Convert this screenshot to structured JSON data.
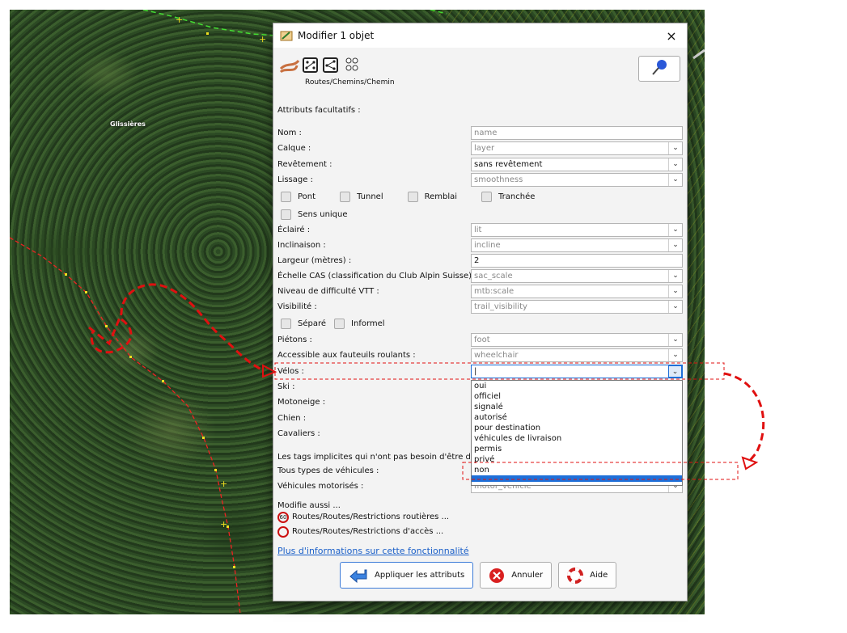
{
  "map": {
    "label": "Glissières"
  },
  "dialog": {
    "title": "Modifier 1 objet",
    "close_glyph": "×",
    "preset_path": "Routes/Chemins/Chemin",
    "section_optional": "Attributs facultatifs :",
    "fields": [
      {
        "label": "Nom :",
        "value": "name",
        "type": "text",
        "filled": false
      },
      {
        "label": "Calque :",
        "value": "layer",
        "type": "select",
        "filled": false
      },
      {
        "label": "Revêtement :",
        "value": "sans revêtement",
        "type": "select",
        "filled": true
      },
      {
        "label": "Lissage :",
        "value": "smoothness",
        "type": "select",
        "filled": false
      }
    ],
    "checkboxes_row1": [
      "Pont",
      "Tunnel",
      "Remblai",
      "Tranchée"
    ],
    "checkboxes_row2": [
      "Sens unique"
    ],
    "fields2": [
      {
        "label": "Éclairé :",
        "value": "lit",
        "type": "select",
        "filled": false
      },
      {
        "label": "Inclinaison :",
        "value": "incline",
        "type": "select",
        "filled": false
      },
      {
        "label": "Largeur (mètres) :",
        "value": "2",
        "type": "text",
        "filled": true
      },
      {
        "label": "Échelle CAS (classification du Club Alpin Suisse) :",
        "value": "sac_scale",
        "type": "select",
        "filled": false
      },
      {
        "label": "Niveau de difficulté VTT :",
        "value": "mtb:scale",
        "type": "select",
        "filled": false
      },
      {
        "label": "Visibilité :",
        "value": "trail_visibility",
        "type": "select",
        "filled": false
      }
    ],
    "checkboxes_row3": [
      "Séparé",
      "Informel"
    ],
    "fields3": [
      {
        "label": "Piétons :",
        "value": "foot",
        "type": "select",
        "filled": false
      },
      {
        "label": "Accessible aux fauteuils roulants :",
        "value": "wheelchair",
        "type": "select",
        "filled": false
      }
    ],
    "velos": {
      "label": "Vélos :",
      "value": "|"
    },
    "hidden_labels": [
      "Ski :",
      "Motoneige :",
      "Chien :",
      "Cavaliers :"
    ],
    "dropdown_options": [
      "oui",
      "officiel",
      "signalé",
      "autorisé",
      "pour destination",
      "véhicules de livraison",
      "permis",
      "privé",
      "non"
    ],
    "implicit_text": "Les tags implicites qui n'ont pas besoin d'être défini",
    "tous_types": "Tous types de véhicules :",
    "vehicules_motorises": "Véhicules motorisés :",
    "vehicules_motorises_value": "motor_vehicle",
    "also_modifies": "Modifie aussi ...",
    "relations": [
      {
        "badge": "60",
        "label": "Routes/Routes/Restrictions routières ..."
      },
      {
        "badge": "",
        "label": "Routes/Routes/Restrictions d'accès ..."
      }
    ],
    "more_info": "Plus d'informations sur cette fonctionnalité",
    "buttons": {
      "apply": "Appliquer les attributs",
      "cancel": "Annuler",
      "help": "Aide"
    }
  },
  "colors": {
    "accent": "#1e6fd9",
    "annotation": "#e01010"
  }
}
